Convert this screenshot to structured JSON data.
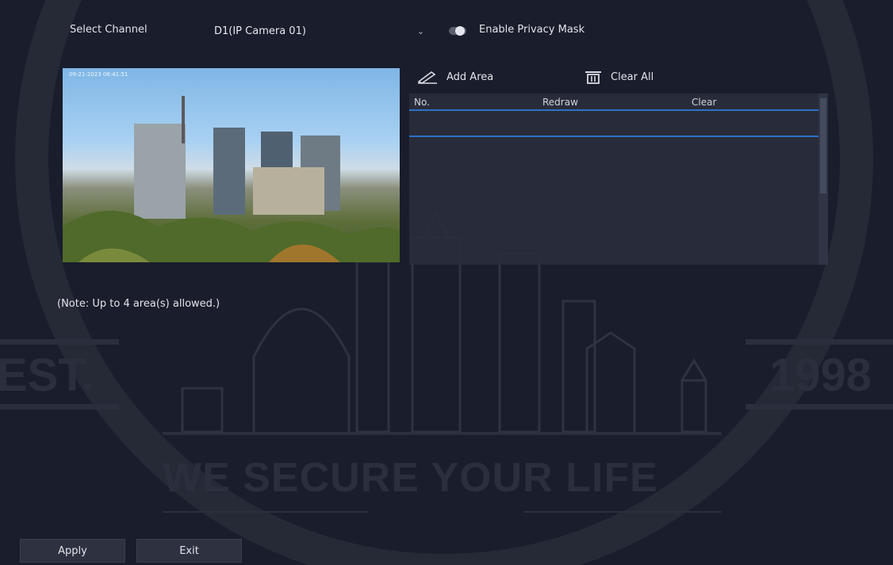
{
  "top": {
    "channel_label": "Select Channel",
    "channel_value": "D1(IP Camera 01)",
    "enable_label": "Enable Privacy Mask",
    "enable_on": false
  },
  "preview": {
    "osd_text": "09-21-2023 08:41:51"
  },
  "toolbar": {
    "add_area_label": "Add Area",
    "add_area_icon": "pencil-icon",
    "clear_all_label": "Clear All",
    "clear_all_icon": "trash-icon"
  },
  "table": {
    "columns": [
      "No.",
      "Redraw",
      "Clear"
    ],
    "rows": []
  },
  "note": "(Note: Up to 4 area(s) allowed.)",
  "buttons": {
    "apply": "Apply",
    "exit": "Exit"
  },
  "watermark": {
    "left": "EST.",
    "right": "1998",
    "slogan": "WE SECURE YOUR LIFE"
  },
  "colors": {
    "background": "#1a1d2b",
    "accent": "#2f7bd9"
  }
}
